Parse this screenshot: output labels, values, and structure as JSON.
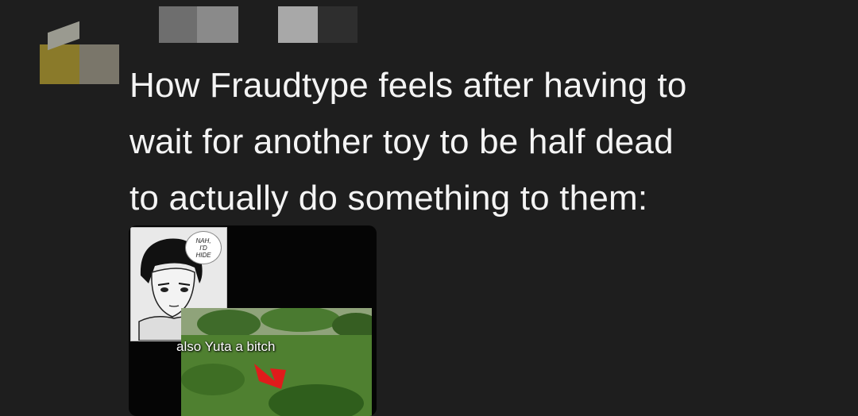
{
  "post": {
    "message": "How Fraudtype feels after having to\nwait for another toy to be half dead\nto actually do something to them:"
  },
  "attachment": {
    "speech_bubble": "NAH,\nI'D\nHIDE",
    "caption": "also Yuta a bitch"
  },
  "colors": {
    "background": "#1e1e1e",
    "text": "#f4f4f4"
  }
}
